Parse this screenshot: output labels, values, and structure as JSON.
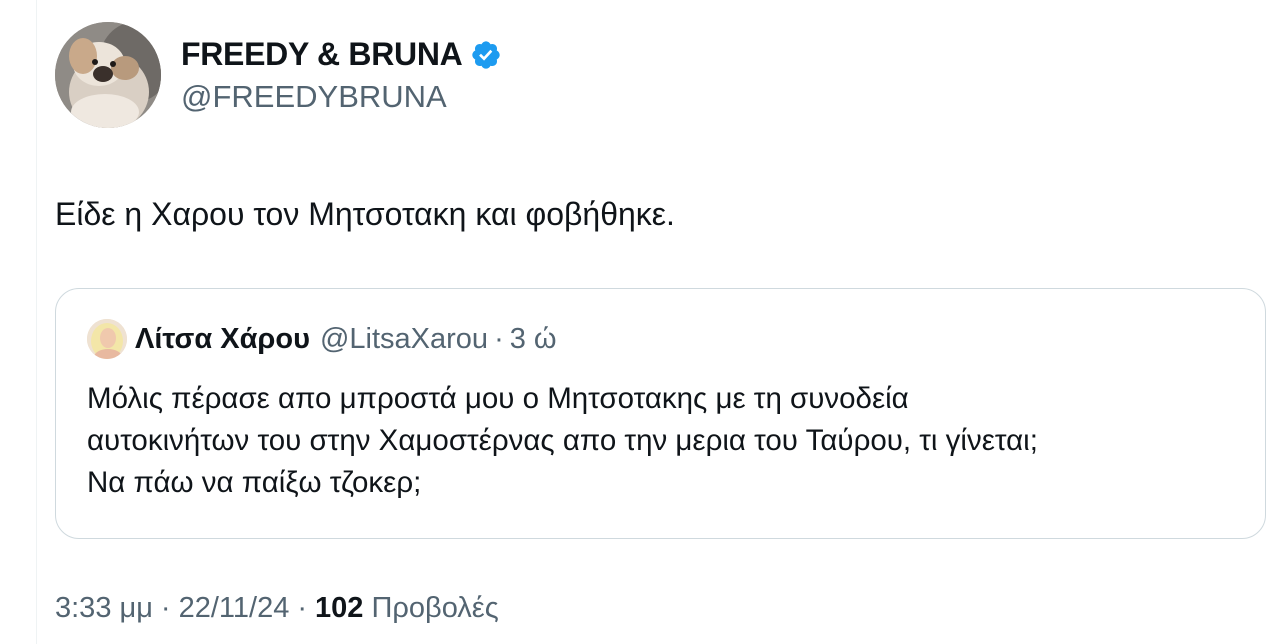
{
  "author": {
    "display_name": "FREEDY & BRUNA",
    "handle": "@FREEDYBRUNA",
    "verified": true
  },
  "tweet": {
    "text": "Είδε η Χαρου τον Μητσοτακη και φοβήθηκε."
  },
  "quoted_tweet": {
    "display_name": "Λίτσα Χάρου",
    "handle": "@LitsaXarou",
    "separator": "·",
    "time": "3 ώ",
    "lines": [
      "Μόλις πέρασε απο μπροστά μου ο Μητσοτακης με τη συνοδεία",
      "αυτοκινήτων του στην Χαμοστέρνας απο την μερια του Ταύρου, τι γίνεται;",
      "Να πάω να παίξω τζοκερ;"
    ]
  },
  "meta": {
    "time": "3:33 μμ",
    "separator": "·",
    "date": "22/11/24",
    "views_count": "102",
    "views_label": "Προβολές"
  },
  "colors": {
    "text_primary": "#0f1419",
    "text_secondary": "#536471",
    "verified_blue": "#1d9bf0",
    "border": "#cfd9de"
  }
}
